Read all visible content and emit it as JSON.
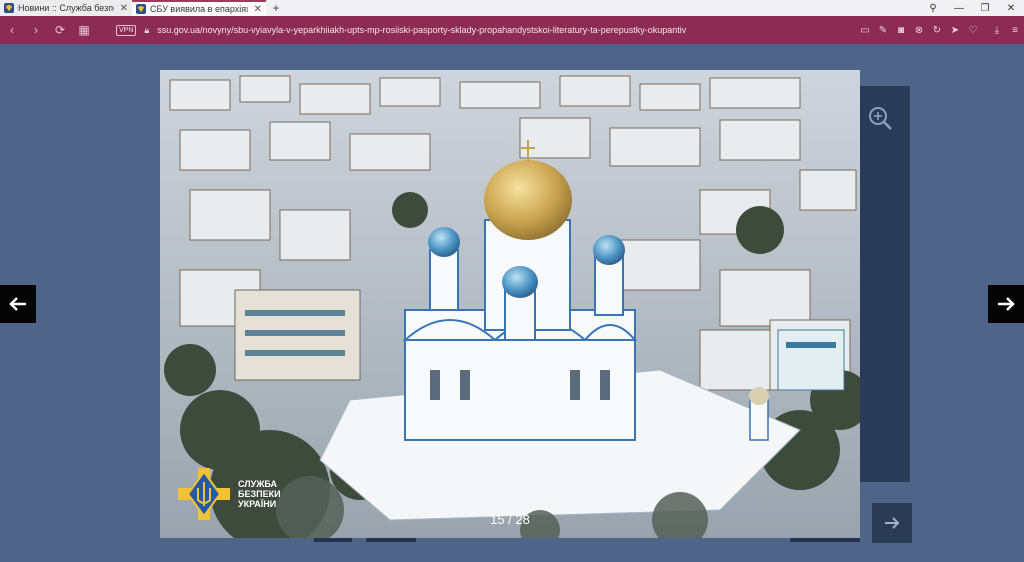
{
  "browser": {
    "tabs": [
      {
        "title": "Новини :: Служба безпеки",
        "active": false
      },
      {
        "title": "СБУ виявила в епархіях УПЦ",
        "active": true
      }
    ],
    "new_tab_label": "+",
    "vpn_label": "VPN",
    "url": "ssu.gov.ua/novyny/sbu-vyiavyla-v-yeparkhiiakh-upts-mp-rosiiski-pasporty-sklady-propahandystskoi-literatury-ta-perepustky-okupantiv",
    "accent_color": "#8c2c52"
  },
  "gallery": {
    "caption_text": "",
    "counter": "15 / 28",
    "logo_text": "СЛУЖБА\nБЕЗПЕКИ\nУКРАЇНИ",
    "logo_emblem": "trident-shield-icon",
    "prev_icon": "arrow-left-icon",
    "next_icon": "arrow-right-icon",
    "zoom_icon": "zoom-in-icon",
    "photo_subject": "aerial-cathedral-photo",
    "background_color": "#4f6489"
  }
}
